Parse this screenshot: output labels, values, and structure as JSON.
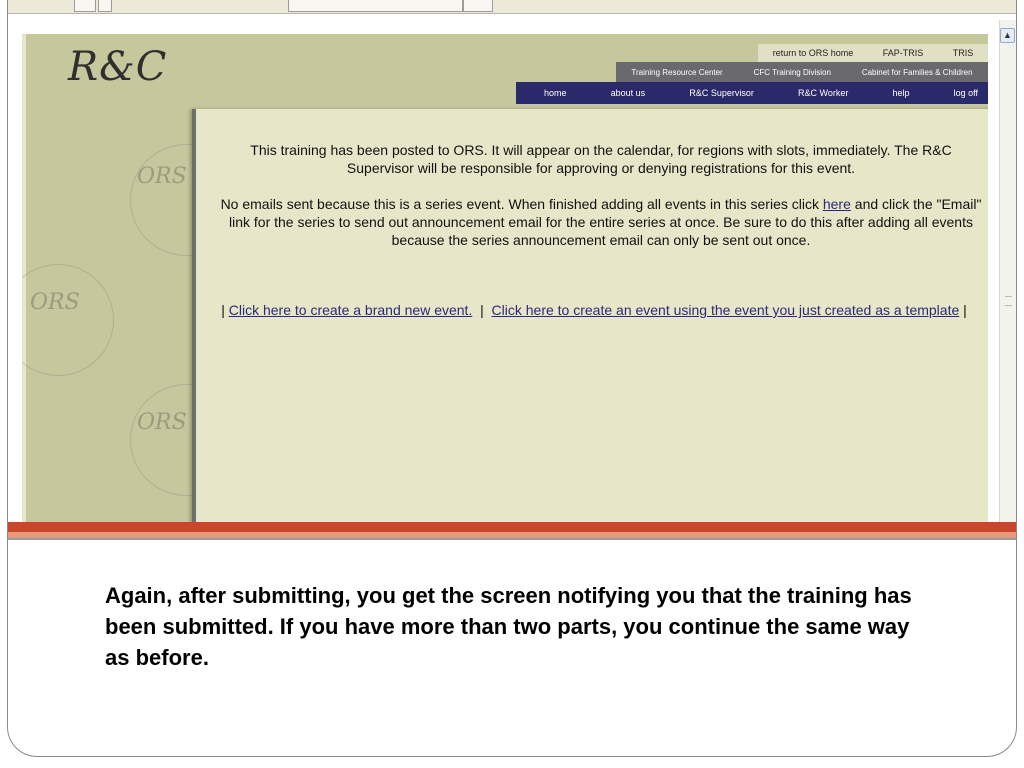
{
  "logo": {
    "text": "R&C"
  },
  "nav": {
    "top": [
      "return to ORS home",
      "FAP-TRIS",
      "TRIS"
    ],
    "mid": [
      "Training Resource Center",
      "CFC Training Division",
      "Cabinet for Families & Children"
    ],
    "main": [
      "home",
      "about us",
      "R&C Supervisor",
      "R&C Worker",
      "help",
      "log off"
    ]
  },
  "watermark": {
    "text": "ORS"
  },
  "content": {
    "message1": "This training has been posted to ORS. It will appear on the calendar, for regions with slots, immediately. The R&C Supervisor will be responsible for approving or denying registrations for this event.",
    "message2_pre": "No emails sent because this is a series event. When finished adding all events in this series click ",
    "message2_link": "here",
    "message2_post": " and click the \"Email\" link for the series to send out announcement email for the entire series at once. Be sure to do this after adding all events because the series announcement email can only be sent out once.",
    "separator": "|",
    "link_new_event": "Click here to create a brand new event.",
    "link_template_event": "Click here to create an event using the event you just created as a template"
  },
  "colors": {
    "page_bg": "#c6c79c",
    "content_bg": "#e8e6c8",
    "nav_main_bg": "#2a2a6a",
    "nav_mid_bg": "#6a6a6e",
    "accent_red": "#c9462c"
  },
  "caption": "Again, after submitting, you get the screen notifying you that the training has been submitted.  If you have more than two parts, you continue the same way as before."
}
